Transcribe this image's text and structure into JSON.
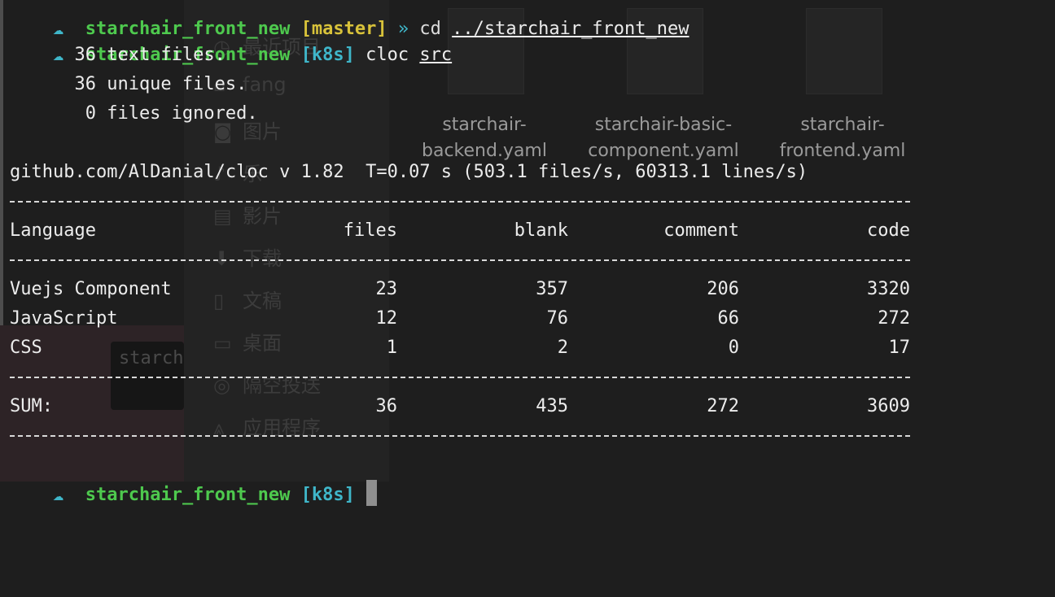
{
  "background": {
    "sidebar_items": [
      {
        "icon": "clock-icon",
        "label": "最近项目"
      },
      {
        "icon": "home-icon",
        "label": "fang"
      },
      {
        "icon": "camera-icon",
        "label": "图片"
      },
      {
        "icon": "music-icon",
        "label": "乐"
      },
      {
        "icon": "film-icon",
        "label": "影片"
      },
      {
        "icon": "download-icon",
        "label": "下载"
      },
      {
        "icon": "document-icon",
        "label": "文稿"
      },
      {
        "icon": "desktop-icon",
        "label": "桌面"
      },
      {
        "icon": "airdrop-icon",
        "label": "隔空投送"
      },
      {
        "icon": "apps-icon",
        "label": "应用程序"
      }
    ],
    "files": [
      {
        "line1": "starchair-",
        "line2": "backend.yaml"
      },
      {
        "line1": "starchair-basic-",
        "line2": "component.yaml"
      },
      {
        "line1": "starchair-",
        "line2": "frontend.yaml"
      }
    ],
    "thumb_text": "starch"
  },
  "terminal": {
    "top_line": {
      "dir": "starchair_front_new",
      "branch": "[master]",
      "arrow": "»",
      "cmd": "cd",
      "arg": "../starchair_front_new"
    },
    "prompt_line": {
      "dir": "starchair_front_new",
      "tag": "[k8s]",
      "cmd": "cloc",
      "arg": "src"
    },
    "summary": [
      "      36 text files.",
      "      36 unique files.",
      "       0 files ignored."
    ],
    "stats_line": "github.com/AlDanial/cloc v 1.82  T=0.07 s (503.1 files/s, 60313.1 lines/s)",
    "headers": {
      "language": "Language",
      "files": "files",
      "blank": "blank",
      "comment": "comment",
      "code": "code"
    },
    "rows": [
      {
        "language": "Vuejs Component",
        "files": "23",
        "blank": "357",
        "comment": "206",
        "code": "3320"
      },
      {
        "language": "JavaScript",
        "files": "12",
        "blank": "76",
        "comment": "66",
        "code": "272"
      },
      {
        "language": "CSS",
        "files": "1",
        "blank": "2",
        "comment": "0",
        "code": "17"
      }
    ],
    "sum": {
      "language": "SUM:",
      "files": "36",
      "blank": "435",
      "comment": "272",
      "code": "3609"
    },
    "final_prompt": {
      "dir": "starchair_front_new",
      "tag": "[k8s]"
    }
  },
  "colors": {
    "prompt_dir": "#4ec94e",
    "prompt_tag": "#3fb6c9",
    "branch": "#d8c23a",
    "background": "#1e1e1e"
  }
}
